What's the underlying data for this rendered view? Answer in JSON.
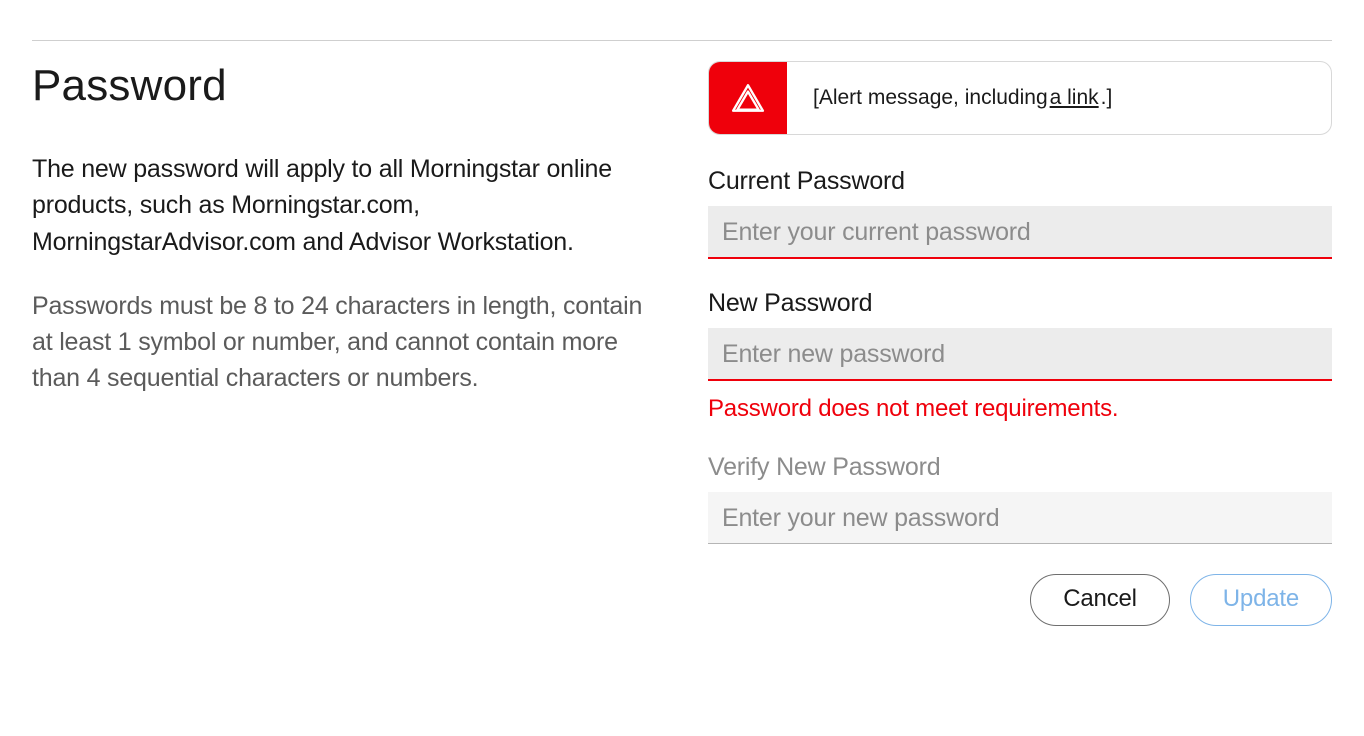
{
  "heading": "Password",
  "description": "The new password will apply to all Morningstar online products, such as Morningstar.com, MorningstarAdvisor.com and Advisor Workstation.",
  "requirements": "Passwords must be 8 to 24 characters in length, contain at least 1 symbol or number, and cannot contain more than 4 sequential characters or numbers.",
  "alert": {
    "prefix": "[Alert message, including ",
    "link_text": "a link",
    "suffix": ".]"
  },
  "fields": {
    "current": {
      "label": "Current Password",
      "placeholder": "Enter your current password",
      "value": ""
    },
    "new": {
      "label": "New Password",
      "placeholder": "Enter new password",
      "value": "",
      "error": "Password does not meet requirements."
    },
    "verify": {
      "label": "Verify New Password",
      "placeholder": "Enter your new password",
      "value": ""
    }
  },
  "buttons": {
    "cancel": "Cancel",
    "update": "Update"
  },
  "colors": {
    "error": "#ef000b",
    "primary_outline": "#7eb4e8"
  }
}
